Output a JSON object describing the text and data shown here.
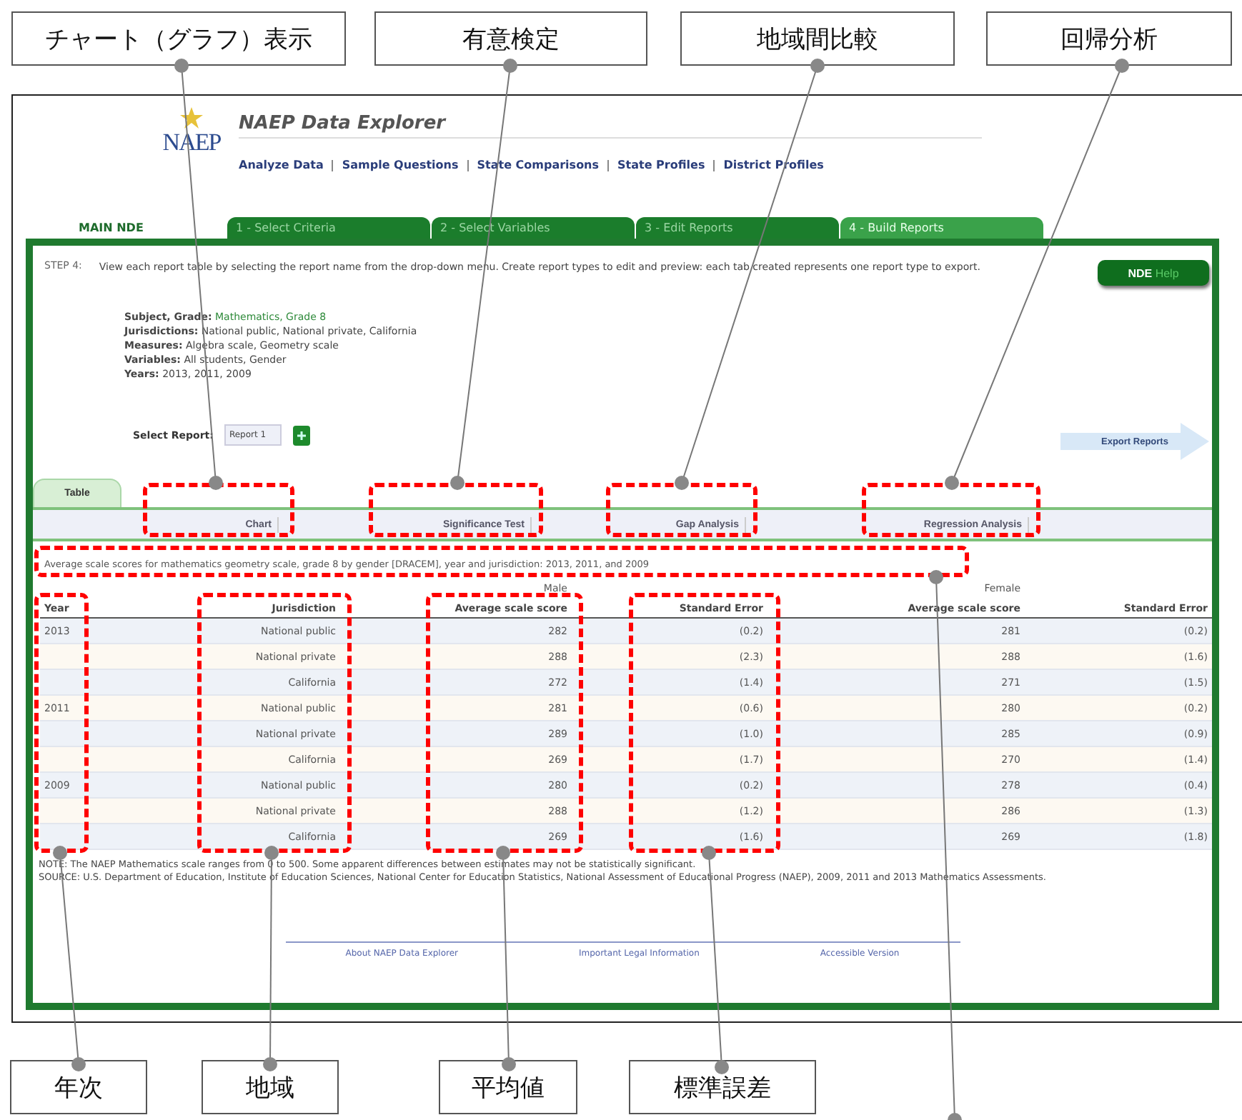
{
  "annotations": {
    "top": [
      "チャート（グラフ）表示",
      "有意検定",
      "地域間比較",
      "回帰分析"
    ],
    "bottom": [
      "年次",
      "地域",
      "平均値",
      "標準誤差"
    ]
  },
  "header": {
    "logo": "NAEP",
    "title": "NAEP Data Explorer",
    "nav": [
      "Analyze Data",
      "Sample Questions",
      "State Comparisons",
      "State Profiles",
      "District Profiles"
    ]
  },
  "mode_label": "MAIN NDE",
  "steps": [
    {
      "label": "1 - Select Criteria",
      "selected": false
    },
    {
      "label": "2 - Select Variables",
      "selected": false
    },
    {
      "label": "3 - Edit Reports",
      "selected": false
    },
    {
      "label": "4 - Build Reports",
      "selected": true
    }
  ],
  "step_info": {
    "step": "STEP 4:",
    "text": "View each report table by selecting the report name from the drop-down menu. Create report types to edit and preview: each tab created represents one report type to export.",
    "details": [
      {
        "label": "Subject, Grade:",
        "value": "Mathematics, Grade 8",
        "highlight": true
      },
      {
        "label": "Jurisdictions:",
        "value": "National public, National private, California",
        "highlight": false
      },
      {
        "label": "Measures:",
        "value": "Algebra scale, Geometry scale",
        "highlight": false
      },
      {
        "label": "Variables:",
        "value": "All students, Gender",
        "highlight": false
      },
      {
        "label": "Years:",
        "value": "2013, 2011, 2009",
        "highlight": false
      }
    ]
  },
  "help_button": {
    "strong": "NDE",
    "light": "Help"
  },
  "select_report": {
    "label": "Select Report:",
    "value": "Report 1"
  },
  "export_button": "Export Reports",
  "report_tab": {
    "label": "Table",
    "selected": true
  },
  "report_types": [
    "Chart",
    "Significance Test",
    "Gap Analysis",
    "Regression Analysis"
  ],
  "table": {
    "caption": "Average scale scores for mathematics geometry scale, grade 8 by gender [DRACEM], year and jurisdiction: 2013, 2011, and 2009",
    "groups": [
      "Male",
      "Female"
    ],
    "columns": [
      "Year",
      "Jurisdiction",
      "Average scale score",
      "Standard Error",
      "Average scale score",
      "Standard Error"
    ],
    "years": [
      {
        "year": "2013",
        "rows": [
          {
            "jurisdiction": "National public",
            "male_score": "282",
            "male_se": "(0.2)",
            "female_score": "281",
            "female_se": "(0.2)"
          },
          {
            "jurisdiction": "National private",
            "male_score": "288",
            "male_se": "(2.3)",
            "female_score": "288",
            "female_se": "(1.6)"
          },
          {
            "jurisdiction": "California",
            "male_score": "272",
            "male_se": "(1.4)",
            "female_score": "271",
            "female_se": "(1.5)"
          }
        ]
      },
      {
        "year": "2011",
        "rows": [
          {
            "jurisdiction": "National public",
            "male_score": "281",
            "male_se": "(0.6)",
            "female_score": "280",
            "female_se": "(0.2)"
          },
          {
            "jurisdiction": "National private",
            "male_score": "289",
            "male_se": "(1.0)",
            "female_score": "285",
            "female_se": "(0.9)"
          },
          {
            "jurisdiction": "California",
            "male_score": "269",
            "male_se": "(1.7)",
            "female_score": "270",
            "female_se": "(1.4)"
          }
        ]
      },
      {
        "year": "2009",
        "rows": [
          {
            "jurisdiction": "National public",
            "male_score": "280",
            "male_se": "(0.2)",
            "female_score": "278",
            "female_se": "(0.4)"
          },
          {
            "jurisdiction": "National private",
            "male_score": "288",
            "male_se": "(1.2)",
            "female_score": "286",
            "female_se": "(1.3)"
          },
          {
            "jurisdiction": "California",
            "male_score": "269",
            "male_se": "(1.6)",
            "female_score": "269",
            "female_se": "(1.8)"
          }
        ]
      }
    ]
  },
  "notes": [
    "NOTE: The NAEP Mathematics scale ranges from 0 to 500. Some apparent differences between estimates may not be statistically significant.",
    "SOURCE: U.S. Department of Education, Institute of Education Sciences, National Center for Education Statistics, National Assessment of Educational Progress (NAEP), 2009, 2011 and 2013 Mathematics Assessments."
  ],
  "footer": [
    "About NAEP Data Explorer",
    "Important Legal Information",
    "Accessible Version"
  ]
}
